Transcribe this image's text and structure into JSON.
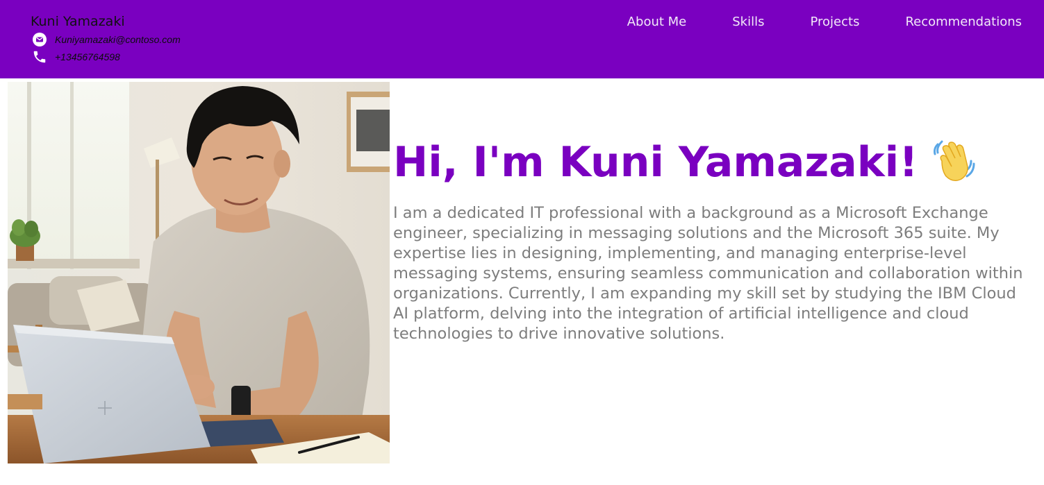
{
  "header": {
    "name": "Kuni Yamazaki",
    "email": "Kuniyamazaki@contoso.com",
    "phone": "+13456764598",
    "background_color": "#7a00c0",
    "email_icon": "email-icon",
    "phone_icon": "phone-icon"
  },
  "nav": {
    "items": [
      {
        "label": "About Me"
      },
      {
        "label": "Skills"
      },
      {
        "label": "Projects"
      },
      {
        "label": "Recommendations"
      }
    ]
  },
  "hero": {
    "title": "Hi, I'm Kuni Yamazaki!",
    "title_icon": "waving-hand-icon",
    "title_color": "#7a00c0",
    "bio": "I am a dedicated IT professional with a background as a Microsoft Exchange engineer, specializing in messaging solutions and the Microsoft 365 suite. My expertise lies in designing, implementing, and managing enterprise-level messaging systems, ensuring seamless communication and collaboration within organizations. Currently, I am expanding my skill set by studying the IBM Cloud AI platform, delving into the integration of artificial intelligence and cloud technologies to drive innovative solutions.",
    "bio_color": "#7d7d7d",
    "photo_subject": "profile-photo"
  }
}
